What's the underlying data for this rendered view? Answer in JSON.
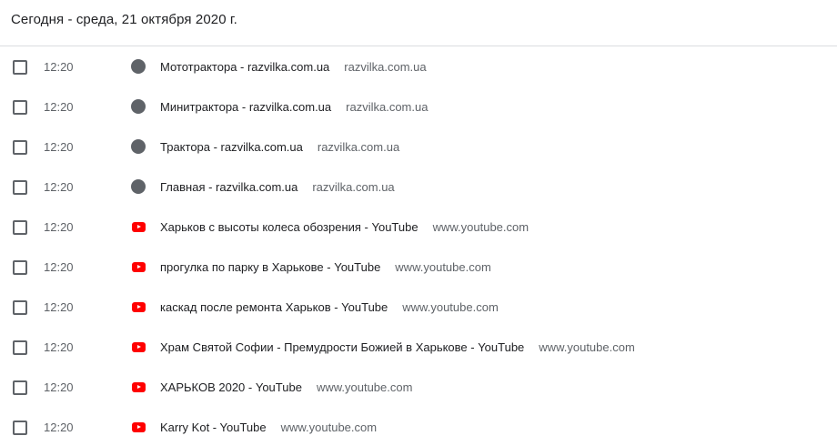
{
  "header": {
    "date_label": "Сегодня - среда, 21 октября 2020 г."
  },
  "entries": [
    {
      "time": "12:20",
      "icon": "gray-circle-icon",
      "title": "Мототрактора - razvilka.com.ua",
      "domain": "razvilka.com.ua"
    },
    {
      "time": "12:20",
      "icon": "gray-circle-icon",
      "title": "Минитрактора - razvilka.com.ua",
      "domain": "razvilka.com.ua"
    },
    {
      "time": "12:20",
      "icon": "gray-circle-icon",
      "title": "Трактора - razvilka.com.ua",
      "domain": "razvilka.com.ua"
    },
    {
      "time": "12:20",
      "icon": "gray-circle-icon",
      "title": "Главная - razvilka.com.ua",
      "domain": "razvilka.com.ua"
    },
    {
      "time": "12:20",
      "icon": "youtube-icon",
      "title": "Харьков с высоты колеса обозрения - YouTube",
      "domain": "www.youtube.com"
    },
    {
      "time": "12:20",
      "icon": "youtube-icon",
      "title": "прогулка по парку в Харькове - YouTube",
      "domain": "www.youtube.com"
    },
    {
      "time": "12:20",
      "icon": "youtube-icon",
      "title": "каскад после ремонта Харьков - YouTube",
      "domain": "www.youtube.com"
    },
    {
      "time": "12:20",
      "icon": "youtube-icon",
      "title": "Храм Святой Софии - Премудрости Божией в Харькове - YouTube",
      "domain": "www.youtube.com"
    },
    {
      "time": "12:20",
      "icon": "youtube-icon",
      "title": "ХАРЬКОВ 2020 - YouTube",
      "domain": "www.youtube.com"
    },
    {
      "time": "12:20",
      "icon": "youtube-icon",
      "title": "Karry Kot - YouTube",
      "domain": "www.youtube.com"
    }
  ]
}
